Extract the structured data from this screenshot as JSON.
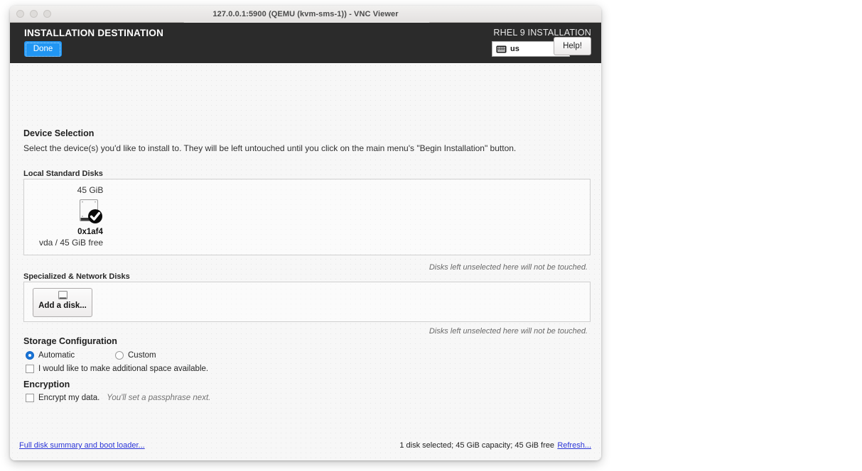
{
  "window": {
    "title": "127.0.0.1:5900 (QEMU (kvm-sms-1)) - VNC Viewer",
    "controls": [
      "close",
      "minimize",
      "maximize"
    ]
  },
  "header": {
    "title": "INSTALLATION DESTINATION",
    "done_label": "Done",
    "install_label": "RHEL 9 INSTALLATION",
    "keyboard_layout": "us",
    "help_label": "Help!",
    "background_color": "#2b2b2b",
    "done_color": "#2196f3"
  },
  "main": {
    "device_selection_title": "Device Selection",
    "device_selection_desc": "Select the device(s) you'd like to install to.  They will be left untouched until you click on the main menu's \"Begin Installation\" button.",
    "local_disks_label": "Local Standard Disks",
    "specialized_disks_label": "Specialized & Network Disks",
    "local_disks": [
      {
        "capacity": "45 GiB",
        "name": "0x1af4",
        "detail": "vda / 45 GiB free",
        "selected": true,
        "icon": "hard-drive-icon"
      }
    ],
    "add_disk_label": "Add a disk...",
    "add_disk_icon": "disk-add-icon",
    "untouched_note": "Disks left unselected here will not be touched."
  },
  "storage": {
    "title": "Storage Configuration",
    "options": [
      {
        "label": "Automatic",
        "selected": true
      },
      {
        "label": "Custom",
        "selected": false
      }
    ],
    "reclaim_label": "I would like to make additional space available.",
    "reclaim_checked": false
  },
  "encryption": {
    "title": "Encryption",
    "label": "Encrypt my data.",
    "hint": "You'll set a passphrase next.",
    "checked": false
  },
  "footer": {
    "full_summary_link": "Full disk summary and boot loader...",
    "status": "1 disk selected; 45 GiB capacity; 45 GiB free",
    "refresh_link": "Refresh...",
    "link_color": "#2b35d8"
  }
}
